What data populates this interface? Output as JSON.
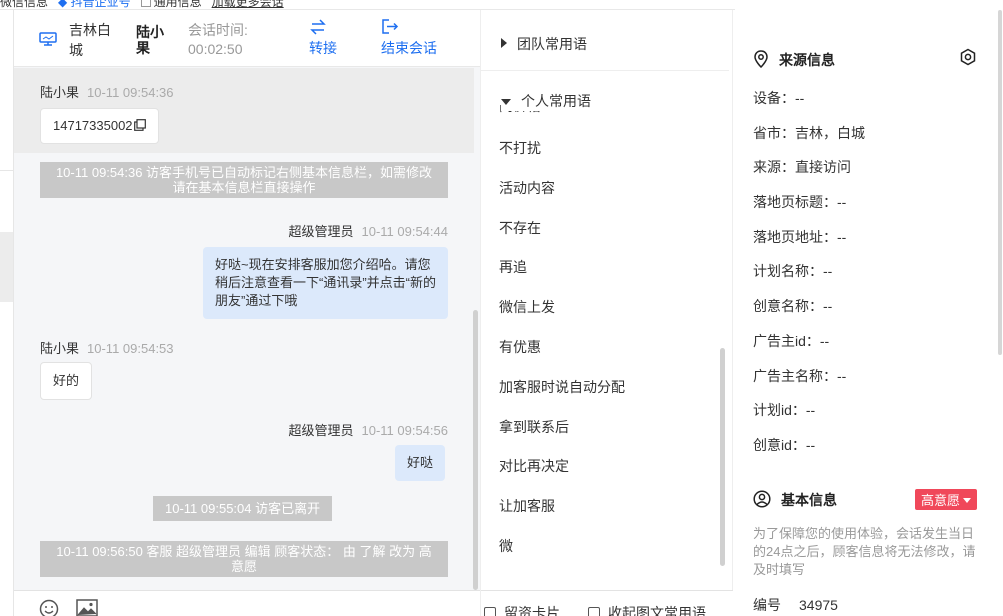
{
  "top_bar": {
    "item1": "微信信息",
    "item2": "抖音企业号",
    "item3": "通用信息",
    "item4": "加载更多会话"
  },
  "chat_header": {
    "location": "吉林白城",
    "visitor_name": "陆小果",
    "time_label": "会话时间:",
    "time_value": "00:02:50",
    "transfer_label": "转接",
    "end_label": "结束会话"
  },
  "messages": {
    "m1_sender": "陆小果",
    "m1_time": "10-11 09:54:36",
    "m1_text": "14717335002",
    "sys1": "10-11 09:54:36 访客手机号已自动标记右侧基本信息栏，如需修改请在基本信息栏直接操作",
    "m2_sender": "超级管理员",
    "m2_time": "10-11 09:54:44",
    "m2_text": "好哒~现在安排客服加您介绍哈。请您稍后注意查看一下“通讯录”并点击“新的朋友”通过下哦",
    "m3_sender": "陆小果",
    "m3_time": "10-11 09:54:53",
    "m3_text": "好的",
    "m4_sender": "超级管理员",
    "m4_time": "10-11 09:54:56",
    "m4_text": "好哒",
    "sys2": "10-11 09:55:04 访客已离开",
    "sys3": "10-11 09:56:50 客服 超级管理员 编辑 顾客状态： 由 了解 改为 高意愿"
  },
  "phrases": {
    "team_group": "团队常用语",
    "personal_group": "个人常用语",
    "cut_item": "问价格",
    "items": [
      "不打扰",
      "活动内容",
      "不存在",
      "再追",
      "微信上发",
      "有优惠",
      "加客服时说自动分配",
      "拿到联系后",
      "对比再决定",
      "让加客服",
      "微"
    ],
    "btn_card": "留资卡片",
    "btn_collect": "收起图文常用语"
  },
  "info": {
    "source_title": "来源信息",
    "fields": [
      "设备：--",
      "省市：吉林，白城",
      "来源：直接访问",
      "落地页标题：--",
      "落地页地址：--",
      "计划名称：--",
      "创意名称：--",
      "广告主id：--",
      "广告主名称：--",
      "计划id：--",
      "创意id：--"
    ],
    "basic_title": "基本信息",
    "intent_badge": "高意愿",
    "notice": "为了保障您的使用体验，会话发生当日的24点之后，顾客信息将无法修改，请及时填写",
    "number_label": "编号",
    "number_value": "34975"
  },
  "colors": {
    "accent": "#1e6ff0",
    "badge": "#f0485a",
    "outgoing_bubble": "#dce9fb",
    "system_message": "#c8c8c8"
  },
  "icons": [
    "monitor-icon",
    "transfer-icon",
    "exit-icon",
    "copy-icon",
    "emoji-icon",
    "image-icon",
    "location-pin-icon",
    "settings-icon",
    "user-circle-icon",
    "card-icon"
  ]
}
